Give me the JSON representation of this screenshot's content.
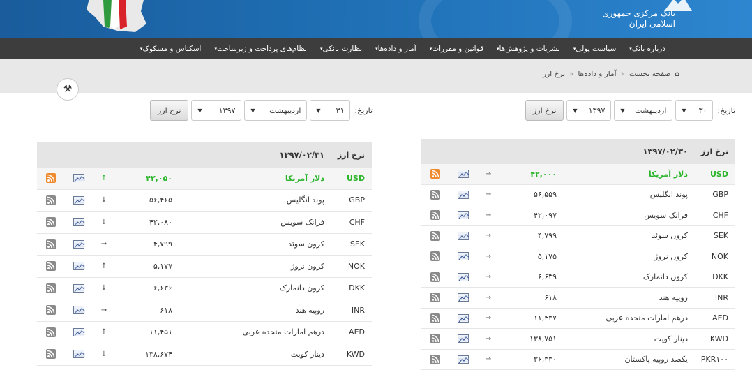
{
  "header": {
    "bank_name_line1": "بانک مرکزی جمهوری",
    "bank_name_line2": "اسلامی ایران"
  },
  "nav": {
    "items": [
      {
        "label": "درباره بانک"
      },
      {
        "label": "سیاست پولی"
      },
      {
        "label": "نشریات و پژوهش‌ها"
      },
      {
        "label": "قوانین و مقررات"
      },
      {
        "label": "آمار و داده‌ها"
      },
      {
        "label": "نظارت بانکی"
      },
      {
        "label": "نظام‌های پرداخت و زیرساخت"
      },
      {
        "label": "اسکناس و مسکوک"
      }
    ]
  },
  "breadcrumb": {
    "home": "صفحه نخست",
    "section": "آمار و داده‌ها",
    "current": "نرخ ارز"
  },
  "left_form": {
    "label": "تاریخ:",
    "day": "۳۰",
    "month": "اردیبهشت",
    "year": "۱۳۹۷",
    "button": "نرخ ارز"
  },
  "right_form": {
    "label": "تاریخ:",
    "day": "۳۱",
    "month": "اردیبهشت",
    "year": "۱۳۹۷",
    "button": "نرخ ارز"
  },
  "table_a": {
    "title": "نرخ ارز",
    "date": "۱۳۹۷/۰۲/۳۰",
    "rows": [
      {
        "code": "USD",
        "name": "دلار آمریکا",
        "value": "۴۲,۰۰۰",
        "trend": "→"
      },
      {
        "code": "GBP",
        "name": "پوند انگلیس",
        "value": "۵۶,۵۵۹",
        "trend": "→"
      },
      {
        "code": "CHF",
        "name": "فرانک سویس",
        "value": "۴۲,۰۹۷",
        "trend": "→"
      },
      {
        "code": "SEK",
        "name": "کرون سوئد",
        "value": "۴,۷۹۹",
        "trend": "→"
      },
      {
        "code": "NOK",
        "name": "کرون نروژ",
        "value": "۵,۱۷۵",
        "trend": "→"
      },
      {
        "code": "DKK",
        "name": "کرون دانمارک",
        "value": "۶,۶۳۹",
        "trend": "→"
      },
      {
        "code": "INR",
        "name": "روپیه هند",
        "value": "۶۱۸",
        "trend": "→"
      },
      {
        "code": "AED",
        "name": "درهم امارات متحده عربی",
        "value": "۱۱,۴۳۷",
        "trend": "→"
      },
      {
        "code": "KWD",
        "name": "دینار کویت",
        "value": "۱۳۸,۷۵۱",
        "trend": "→"
      },
      {
        "code": "PKR۱۰۰",
        "name": "یکصد روپیه پاکستان",
        "value": "۳۶,۳۳۰",
        "trend": "→"
      }
    ]
  },
  "table_b": {
    "title": "نرخ ارز",
    "date": "۱۳۹۷/۰۲/۳۱",
    "rows": [
      {
        "code": "USD",
        "name": "دلار آمریکا",
        "value": "۴۲,۰۵۰",
        "trend": "↑"
      },
      {
        "code": "GBP",
        "name": "پوند انگلیس",
        "value": "۵۶,۴۶۵",
        "trend": "↓"
      },
      {
        "code": "CHF",
        "name": "فرانک سویس",
        "value": "۴۲,۰۸۰",
        "trend": "↓"
      },
      {
        "code": "SEK",
        "name": "کرون سوئد",
        "value": "۴,۷۹۹",
        "trend": "→"
      },
      {
        "code": "NOK",
        "name": "کرون نروژ",
        "value": "۵,۱۷۷",
        "trend": "↑"
      },
      {
        "code": "DKK",
        "name": "کرون دانمارک",
        "value": "۶,۶۳۶",
        "trend": "↓"
      },
      {
        "code": "INR",
        "name": "روپیه هند",
        "value": "۶۱۸",
        "trend": "→"
      },
      {
        "code": "AED",
        "name": "درهم امارات متحده عربی",
        "value": "۱۱,۴۵۱",
        "trend": "↑"
      },
      {
        "code": "KWD",
        "name": "دینار کویت",
        "value": "۱۳۸,۶۷۴",
        "trend": "↓"
      }
    ]
  },
  "colors": {
    "header_blue": "#1f6fb4",
    "nav_bg": "#3d3d3d",
    "highlight_green": "#2bb52b",
    "rss_orange": "#ef8a2e"
  }
}
